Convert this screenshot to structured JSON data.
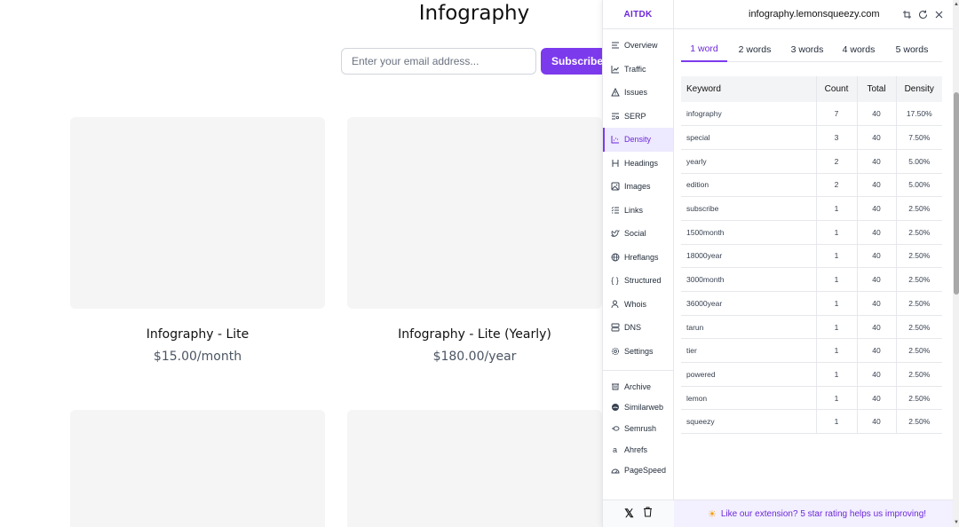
{
  "page": {
    "title": "Infography",
    "email_placeholder": "Enter your email address...",
    "subscribe_label": "Subscribe",
    "products": [
      {
        "name": "Infography - Lite",
        "price": "$15.00/month"
      },
      {
        "name": "Infography - Lite (Yearly)",
        "price": "$180.00/year"
      }
    ]
  },
  "extension": {
    "brand": "AITDK",
    "domain": "infography.lemonsqueezy.com",
    "nav_items": [
      {
        "label": "Overview",
        "icon": "list-icon"
      },
      {
        "label": "Traffic",
        "icon": "line-chart-icon"
      },
      {
        "label": "Issues",
        "icon": "warning-icon"
      },
      {
        "label": "SERP",
        "icon": "serp-icon"
      },
      {
        "label": "Density",
        "icon": "density-icon"
      },
      {
        "label": "Headings",
        "icon": "heading-icon"
      },
      {
        "label": "Images",
        "icon": "image-icon"
      },
      {
        "label": "Links",
        "icon": "list-checks-icon"
      },
      {
        "label": "Social",
        "icon": "twitter-icon"
      },
      {
        "label": "Hreflangs",
        "icon": "globe-icon"
      },
      {
        "label": "Structured",
        "icon": "braces-icon"
      },
      {
        "label": "Whois",
        "icon": "user-icon"
      },
      {
        "label": "DNS",
        "icon": "server-icon"
      },
      {
        "label": "Settings",
        "icon": "gear-icon"
      }
    ],
    "active_nav": "Density",
    "tools": [
      {
        "label": "Archive",
        "icon": "archive-icon"
      },
      {
        "label": "Similarweb",
        "icon": "similarweb-icon"
      },
      {
        "label": "Semrush",
        "icon": "semrush-icon"
      },
      {
        "label": "Ahrefs",
        "icon": "ahrefs-icon"
      },
      {
        "label": "PageSpeed",
        "icon": "pagespeed-icon"
      }
    ],
    "tabs": [
      "1 word",
      "2 words",
      "3 words",
      "4 words",
      "5 words"
    ],
    "active_tab": "1 word",
    "table": {
      "headers": [
        "Keyword",
        "Count",
        "Total",
        "Density"
      ],
      "rows": [
        [
          "infography",
          "7",
          "40",
          "17.50%"
        ],
        [
          "special",
          "3",
          "40",
          "7.50%"
        ],
        [
          "yearly",
          "2",
          "40",
          "5.00%"
        ],
        [
          "edition",
          "2",
          "40",
          "5.00%"
        ],
        [
          "subscribe",
          "1",
          "40",
          "2.50%"
        ],
        [
          "1500month",
          "1",
          "40",
          "2.50%"
        ],
        [
          "18000year",
          "1",
          "40",
          "2.50%"
        ],
        [
          "3000month",
          "1",
          "40",
          "2.50%"
        ],
        [
          "36000year",
          "1",
          "40",
          "2.50%"
        ],
        [
          "tarun",
          "1",
          "40",
          "2.50%"
        ],
        [
          "tier",
          "1",
          "40",
          "2.50%"
        ],
        [
          "powered",
          "1",
          "40",
          "2.50%"
        ],
        [
          "lemon",
          "1",
          "40",
          "2.50%"
        ],
        [
          "squeezy",
          "1",
          "40",
          "2.50%"
        ]
      ]
    },
    "footer_text": "Like our extension? 5 star rating helps us improving!",
    "accent": "#7c3aed"
  }
}
